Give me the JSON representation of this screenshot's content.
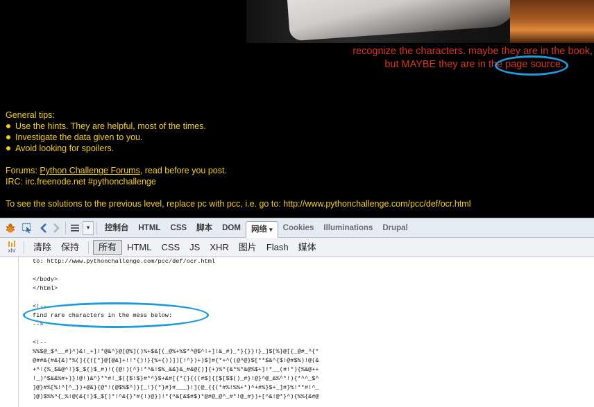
{
  "webpage": {
    "hint_line1": "recognize the characters. maybe they are in the book,",
    "hint_line2_prefix": "but MAYBE they are in the ",
    "hint_line2_link": "page source.",
    "tips_heading": "General tips:",
    "tips": [
      "Use the hints. They are helpful, most of the times.",
      "Investigate the data given to you.",
      "Avoid looking for spoilers."
    ],
    "forums_prefix": "Forums: ",
    "forums_link": "Python Challenge Forums",
    "forums_suffix": ", read before you post.",
    "irc": "IRC: irc.freenode.net #pythonchallenge",
    "solutions": "To see the solutions to the previous level, replace pc with pcc, i.e. go to: http://www.pythonchallenge.com/pcc/def/ocr.html"
  },
  "firebug_toolbar": {
    "tabs": [
      "控制台",
      "HTML",
      "CSS",
      "脚本",
      "DOM",
      "网络",
      "Cookies",
      "Illuminations",
      "Drupal"
    ],
    "selected_tab": "网络"
  },
  "net_filter": {
    "xhr_icon_label": "xhr",
    "clear": "清除",
    "persist": "保持",
    "filters": [
      "所有",
      "HTML",
      "CSS",
      "JS",
      "XHR",
      "图片",
      "Flash",
      "媒体"
    ],
    "selected_filter": "所有"
  },
  "source": {
    "lines": [
      "to: http://www.pythonchallenge.com/pcc/def/ocr.html",
      "",
      "</body>",
      "</html>",
      "",
      "<!--",
      "find rare characters in the mess below:",
      "-->",
      "",
      "<!--",
      "%%$@_$^__#)^)&!_+]!*@&^}@[@%]()%+$&[(_@%+%$*^@$^!+]!&_#)_*}{}}!}_]$[%}@[{_@#_^{*",
      "@##&{#&{&)*%(]{{([*}@[@&]+!!*{)!}{%+{))])[!^})+)$]#{*+^((@^@}$[**$&^{$!@#$%)!@(&",
      "+^!{%_$&@^!}$_${)$_#)!({@!)(^}!*^&!$%_&&}&_#&@{)]{+)%*{&*%*&@%$+]!*__(#!*){%&@++",
      "!_)^$&&%#+)}!@!)&^}**#!_$([$!$}#*^}$+&#[{*{}{((#$]{[$[$$()_#}!@}^@_&%^*!){*^^_$^",
      "]@}#%[%!^[^_})+@&}{@*!(@$%$^)}[_!}(*}#}#___}!](@_{{(*#%!%%+*)^+#%}$+_]#}%!**#!^_",
      ")@)$%%^{_%!@(&{!}$_$[)*!^&{}*#{!)@})!*{^&[&$#$)*@#@_@^_#*!@_#})+[^&!@*}^){%%{&#@"
    ]
  }
}
